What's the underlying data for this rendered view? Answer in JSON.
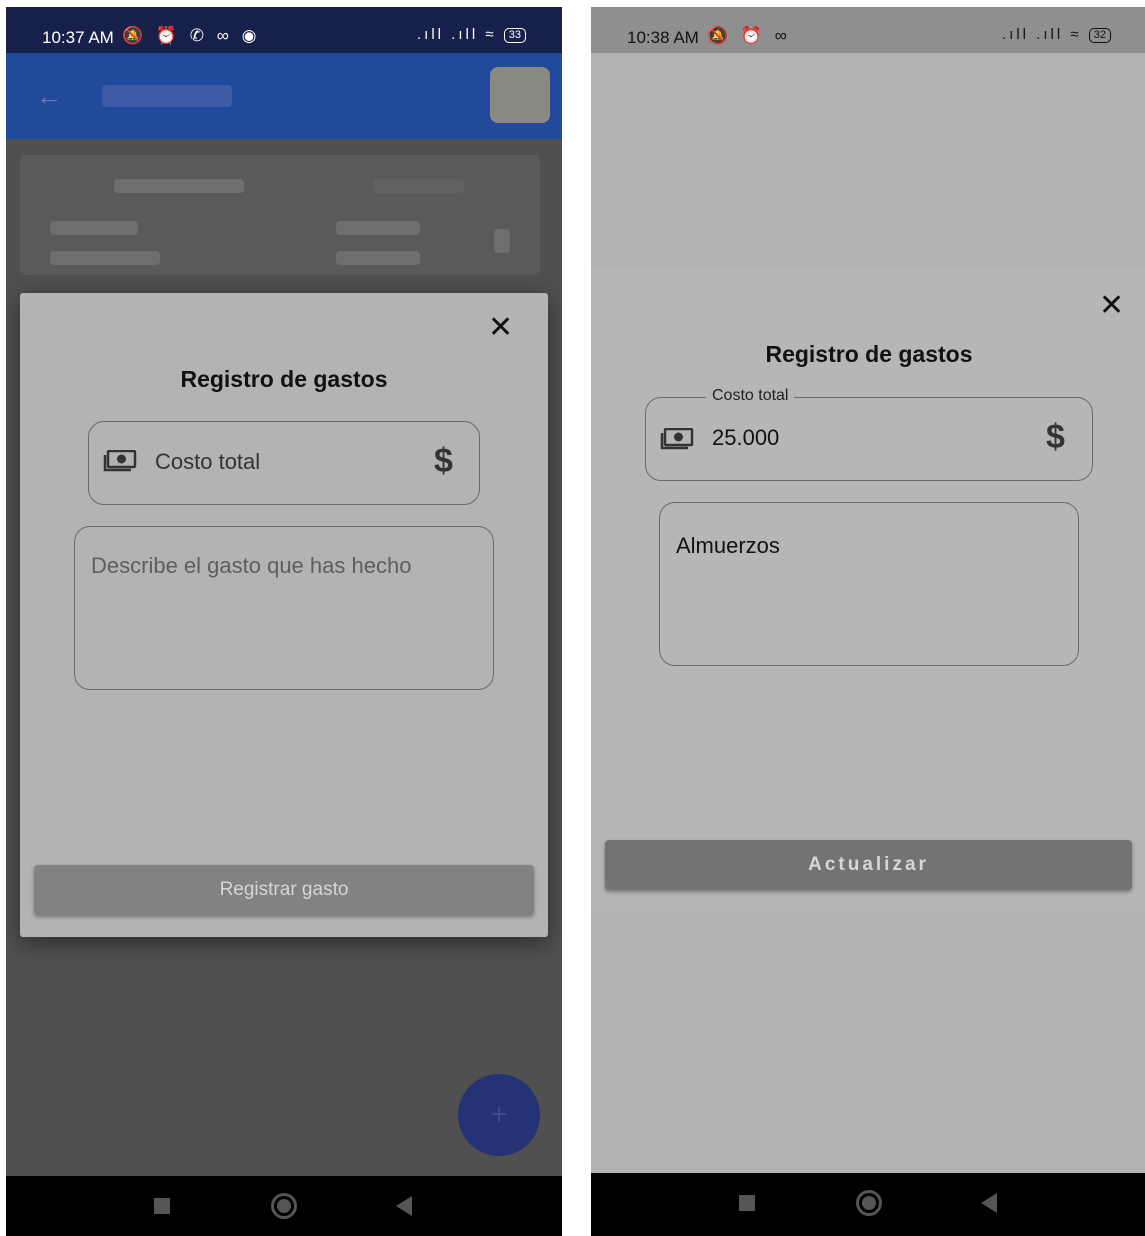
{
  "left": {
    "status_time": "10:37 AM",
    "status_icons_left": "🔕 ⏰ ✆ ∞ ◉",
    "status_icons_right": ".ıll .ıll ≈",
    "battery": "33",
    "dialog": {
      "title": "Registro de gastos",
      "cost_placeholder": "Costo total",
      "currency_symbol": "$",
      "description_placeholder": "Describe el gasto que has hecho",
      "submit_label": "Registrar gasto",
      "close_symbol": "✕"
    }
  },
  "right": {
    "status_time": "10:38 AM",
    "status_icons_left": "🔕 ⏰ ∞",
    "status_icons_right": ".ıll .ıll ≈",
    "battery": "32",
    "dialog": {
      "title": "Registro de gastos",
      "cost_label": "Costo total",
      "cost_value": "25.000",
      "currency_symbol": "$",
      "description_value": "Almuerzos",
      "submit_label": "Actualizar",
      "close_symbol": "✕"
    }
  },
  "icons": {
    "cash": "cash-icon",
    "close": "close-icon",
    "nav_recent": "recent-apps-icon",
    "nav_home": "home-icon",
    "nav_back": "back-icon"
  },
  "colors": {
    "scrim_left": "#505050",
    "dialog_bg": "#b3b3b3",
    "left_button": "#828282",
    "right_button": "#737373",
    "fab": "#253275"
  }
}
